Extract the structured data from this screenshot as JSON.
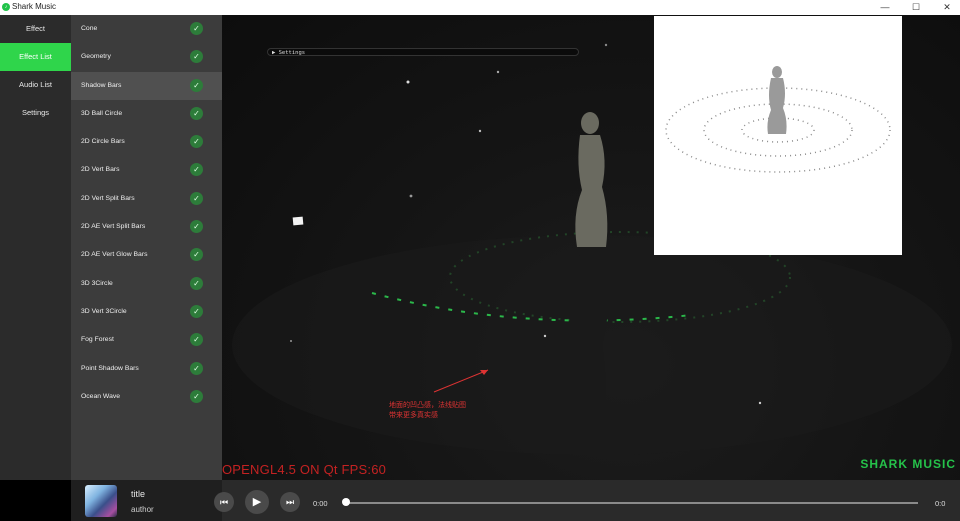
{
  "window": {
    "title": "Shark Music",
    "icon": "shark-logo-icon",
    "controls": [
      "—",
      "☐",
      "✕"
    ]
  },
  "nav": {
    "items": [
      "Effect",
      "Effect List",
      "Audio List",
      "Settings"
    ],
    "active_index": 1
  },
  "effect_list": {
    "items": [
      "Cone",
      "Geometry",
      "Shadow Bars",
      "3D Ball Circle",
      "2D Circle Bars",
      "2D Vert Bars",
      "2D Vert Split Bars",
      "2D AE Vert Split Bars",
      "2D AE Vert Glow Bars",
      "3D 3Circle",
      "3D Vert 3Circle",
      "Fog Forest",
      "Point Shadow Bars",
      "Ocean Wave"
    ],
    "selected_index": 2,
    "check_glyph": "✓"
  },
  "canvas": {
    "settings_label": "▶ Settings",
    "gl_info": "OPENGL4.5 ON Qt FPS:60",
    "brand": "SHARK MUSIC",
    "annotation_line1": "地面的凹凸感，法线贴图",
    "annotation_line2": "带来更多真实感"
  },
  "player": {
    "title": "title",
    "author": "author",
    "current_time": "0:00",
    "total_time": "0:0",
    "progress": 0,
    "prev_icon": "⏮",
    "play_icon": "▶",
    "next_icon": "⏭"
  },
  "colors": {
    "accent": "#2fd54b",
    "gl_text": "#c42222",
    "annotation": "#dd3333"
  }
}
